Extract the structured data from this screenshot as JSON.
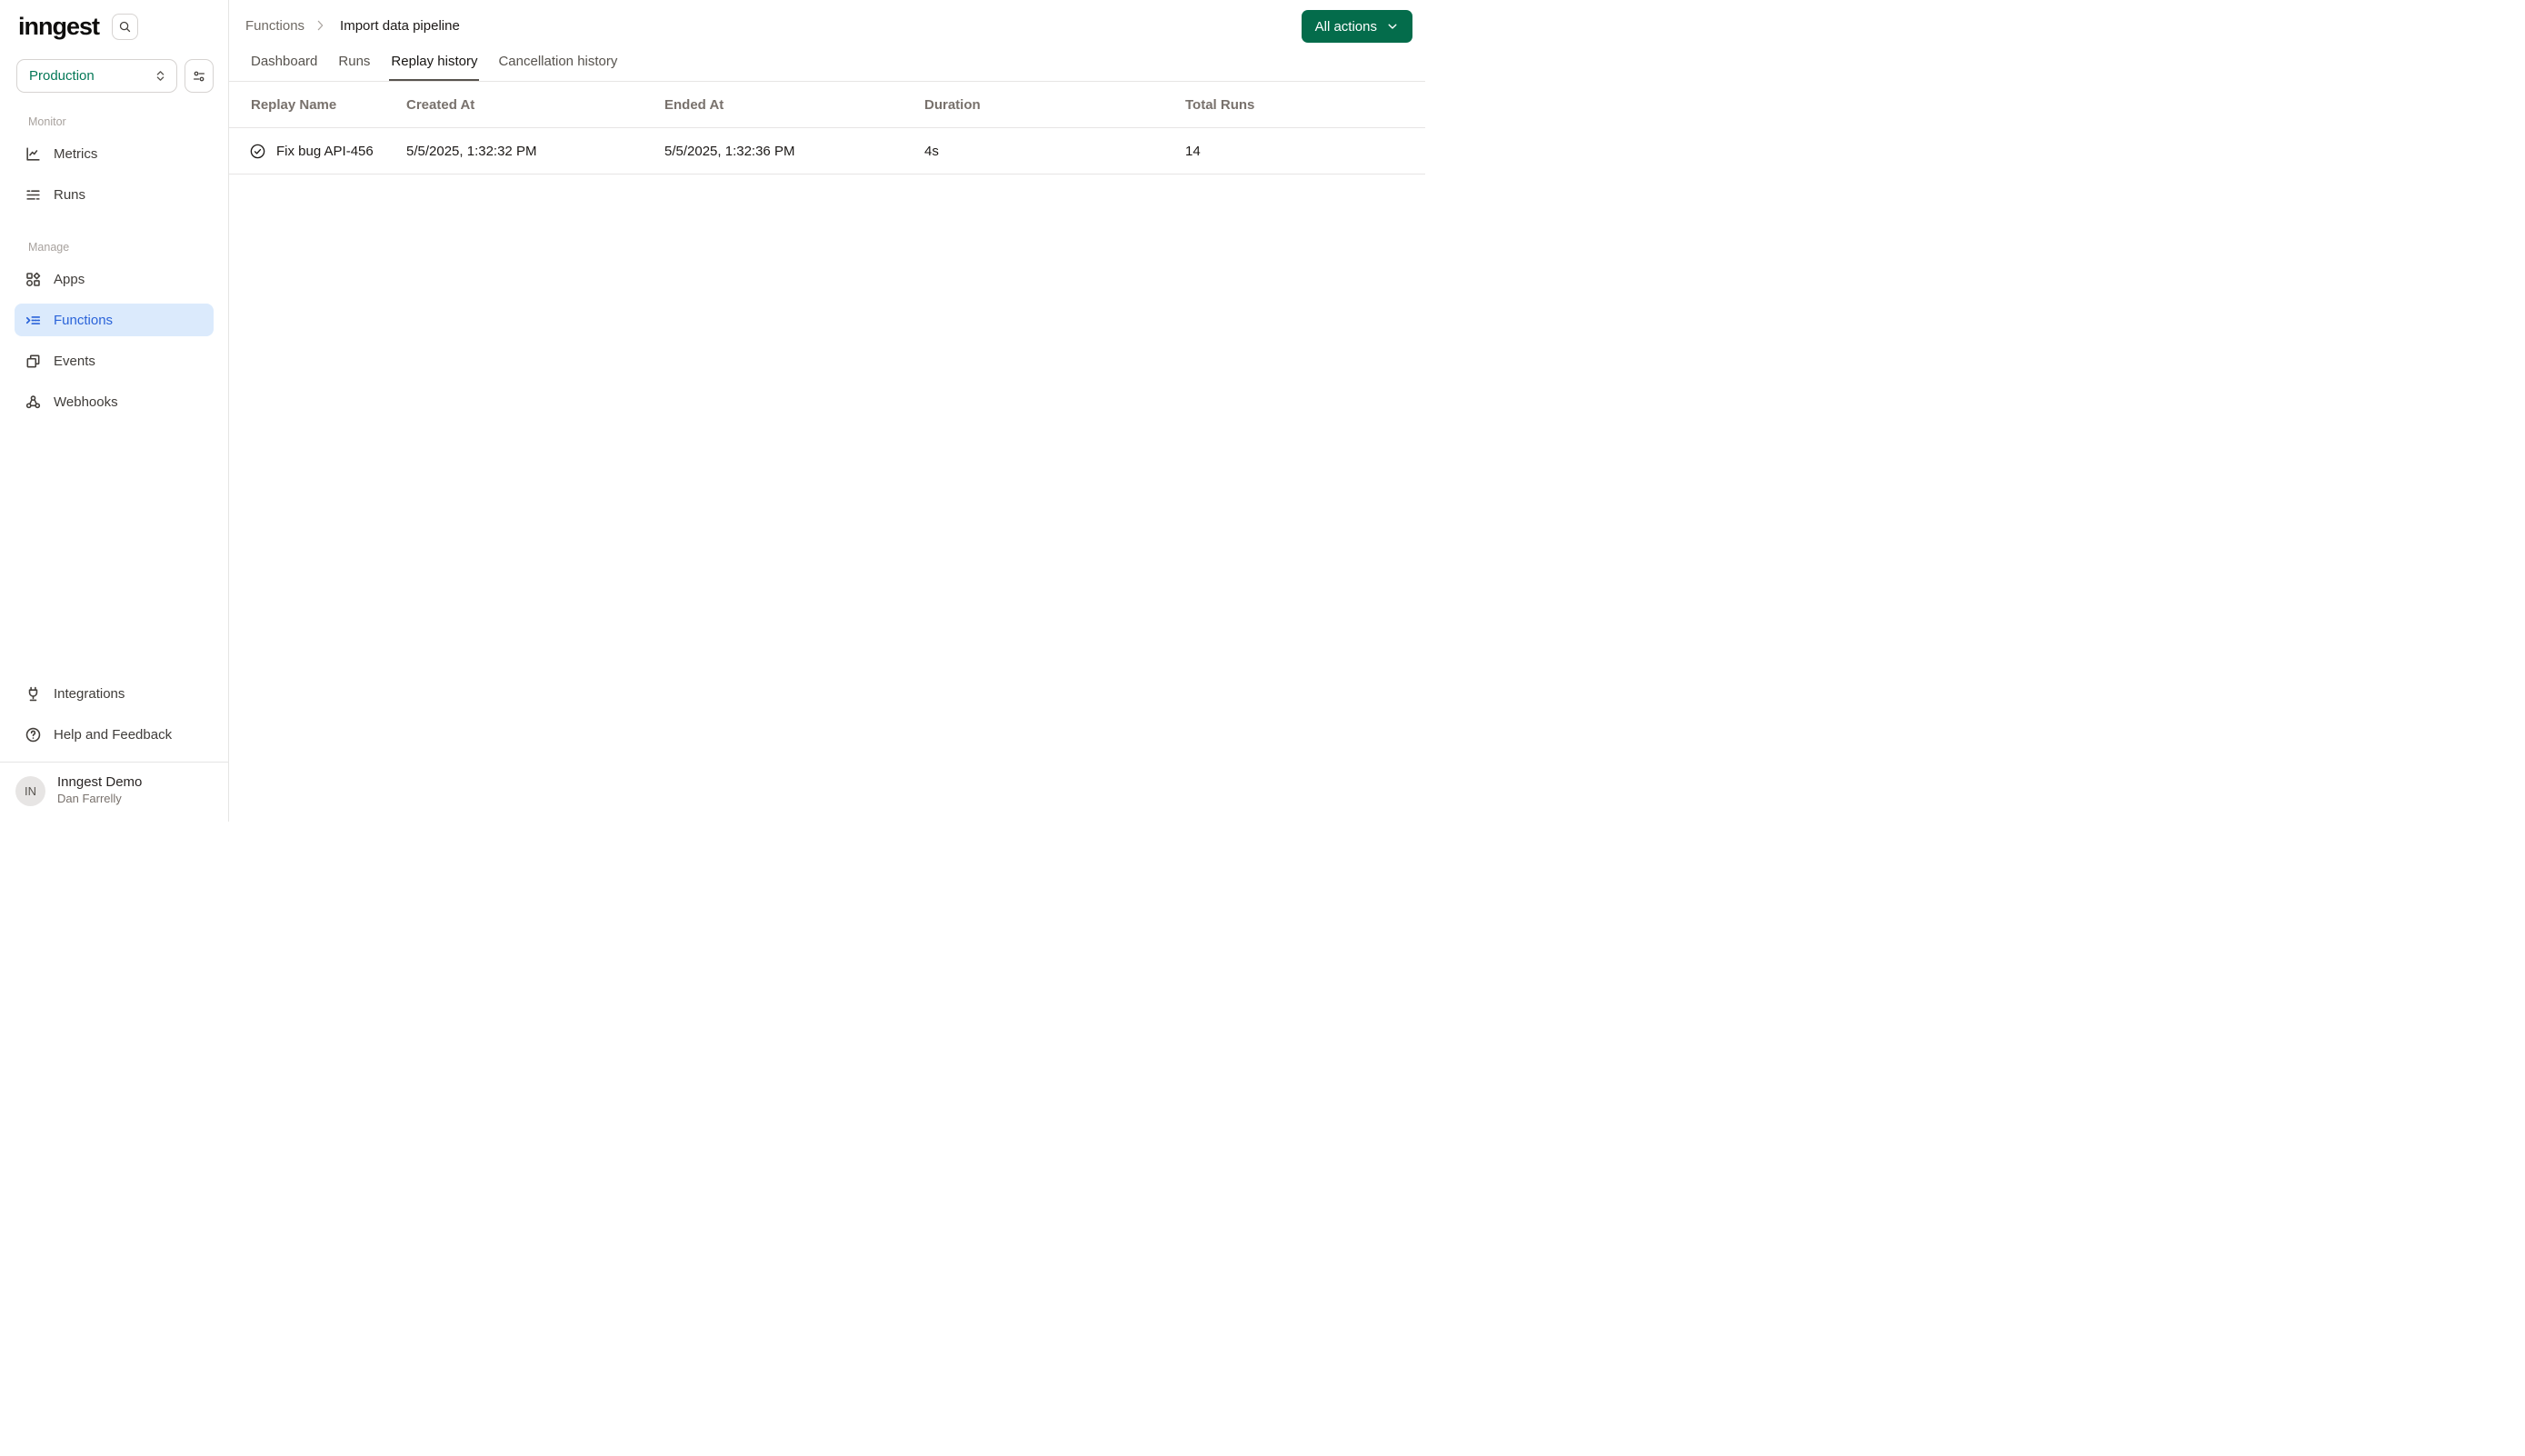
{
  "colors": {
    "brand_green": "#046c4b",
    "env_green": "#047857",
    "active_blue_text": "#2a63d9",
    "active_blue_bg": "#dbeafc",
    "border": "#e7e5e4"
  },
  "sidebar": {
    "logo": "inngest",
    "search_icon": "search-icon",
    "env_selector": {
      "value": "Production",
      "icon": "chevron-up-down-icon"
    },
    "env_filter_icon": "sliders-icon",
    "sections": [
      {
        "label": "Monitor",
        "items": [
          {
            "label": "Metrics",
            "icon": "chart-line-icon",
            "active": false
          },
          {
            "label": "Runs",
            "icon": "list-lines-icon",
            "active": false
          }
        ]
      },
      {
        "label": "Manage",
        "items": [
          {
            "label": "Apps",
            "icon": "shapes-grid-icon",
            "active": false
          },
          {
            "label": "Functions",
            "icon": "function-list-icon",
            "active": true
          },
          {
            "label": "Events",
            "icon": "copy-squares-icon",
            "active": false
          },
          {
            "label": "Webhooks",
            "icon": "webhook-icon",
            "active": false
          }
        ]
      }
    ],
    "footer_items": [
      {
        "label": "Integrations",
        "icon": "plug-icon"
      },
      {
        "label": "Help and Feedback",
        "icon": "help-circle-icon"
      }
    ],
    "user": {
      "initials": "IN",
      "org": "Inngest Demo",
      "name": "Dan Farrelly"
    }
  },
  "header": {
    "breadcrumb": {
      "parent": "Functions",
      "current": "Import data pipeline"
    },
    "actions_button": "All actions"
  },
  "tabs": [
    {
      "label": "Dashboard",
      "active": false
    },
    {
      "label": "Runs",
      "active": false
    },
    {
      "label": "Replay history",
      "active": true
    },
    {
      "label": "Cancellation history",
      "active": false
    }
  ],
  "table": {
    "columns": [
      "Replay Name",
      "Created At",
      "Ended At",
      "Duration",
      "Total Runs"
    ],
    "rows": [
      {
        "status_icon": "check-circle-icon",
        "name": "Fix bug API-456",
        "created_at": "5/5/2025, 1:32:32 PM",
        "ended_at": "5/5/2025, 1:32:36 PM",
        "duration": "4s",
        "total_runs": "14"
      }
    ]
  }
}
